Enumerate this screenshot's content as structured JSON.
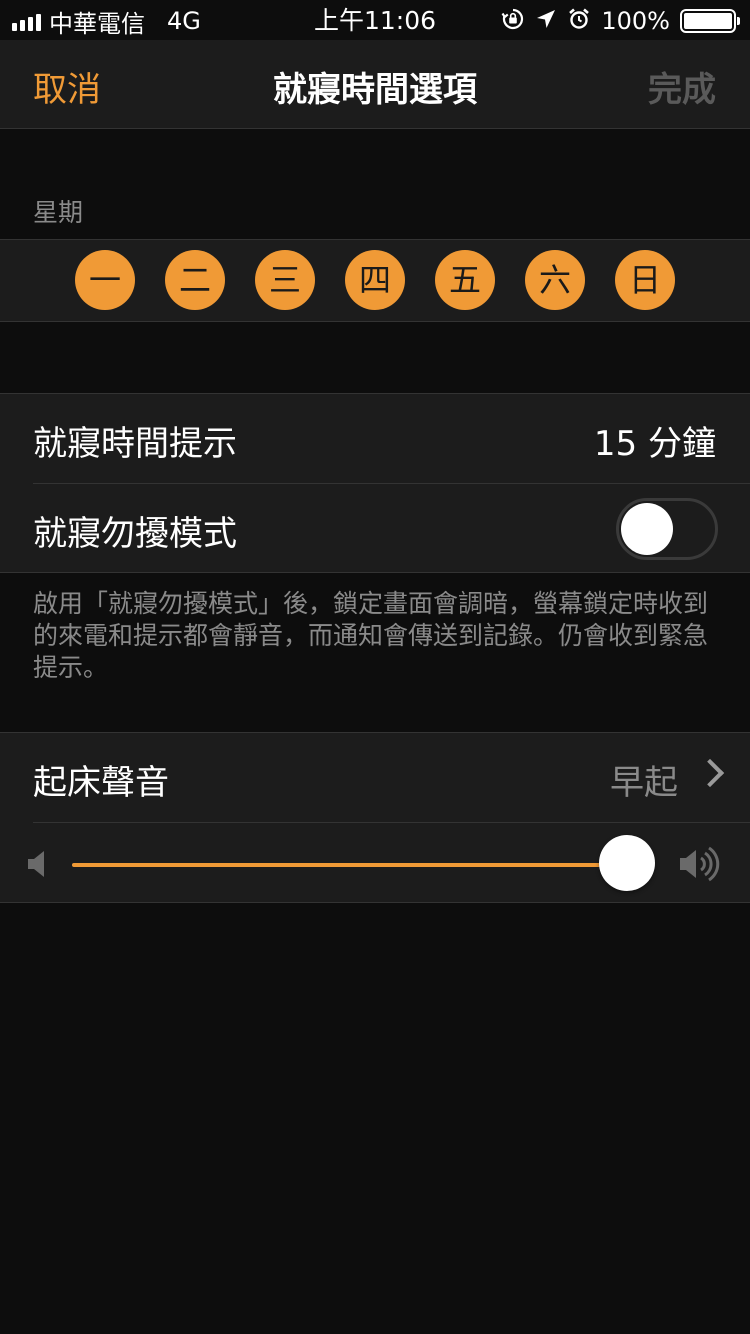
{
  "status_bar": {
    "carrier": "中華電信",
    "network": "4G",
    "time": "上午11:06",
    "battery_text": "100%",
    "icons": [
      "signal-icon",
      "rotation-lock-icon",
      "location-arrow-icon",
      "alarm-icon",
      "battery-icon"
    ]
  },
  "nav": {
    "cancel_label": "取消",
    "title": "就寢時間選項",
    "done_label": "完成"
  },
  "days_section": {
    "label": "星期",
    "days": [
      "一",
      "二",
      "三",
      "四",
      "五",
      "六",
      "日"
    ]
  },
  "reminder": {
    "label": "就寢時間提示",
    "value": "15 分鐘"
  },
  "dnd": {
    "label": "就寢勿擾模式",
    "enabled": false,
    "footnote": "啟用「就寢勿擾模式」後，鎖定畫面會調暗，螢幕鎖定時收到的來電和提示都會靜音，而通知會傳送到記錄。仍會收到緊急提示。"
  },
  "wake_sound": {
    "label": "起床聲音",
    "value": "早起"
  },
  "volume": {
    "level": 1.0
  },
  "colors": {
    "accent": "#f09a36",
    "background": "#0d0d0d",
    "group_background": "#1c1c1c",
    "secondary_text": "#8a8a8a",
    "disabled_text": "#5a5a5a"
  }
}
